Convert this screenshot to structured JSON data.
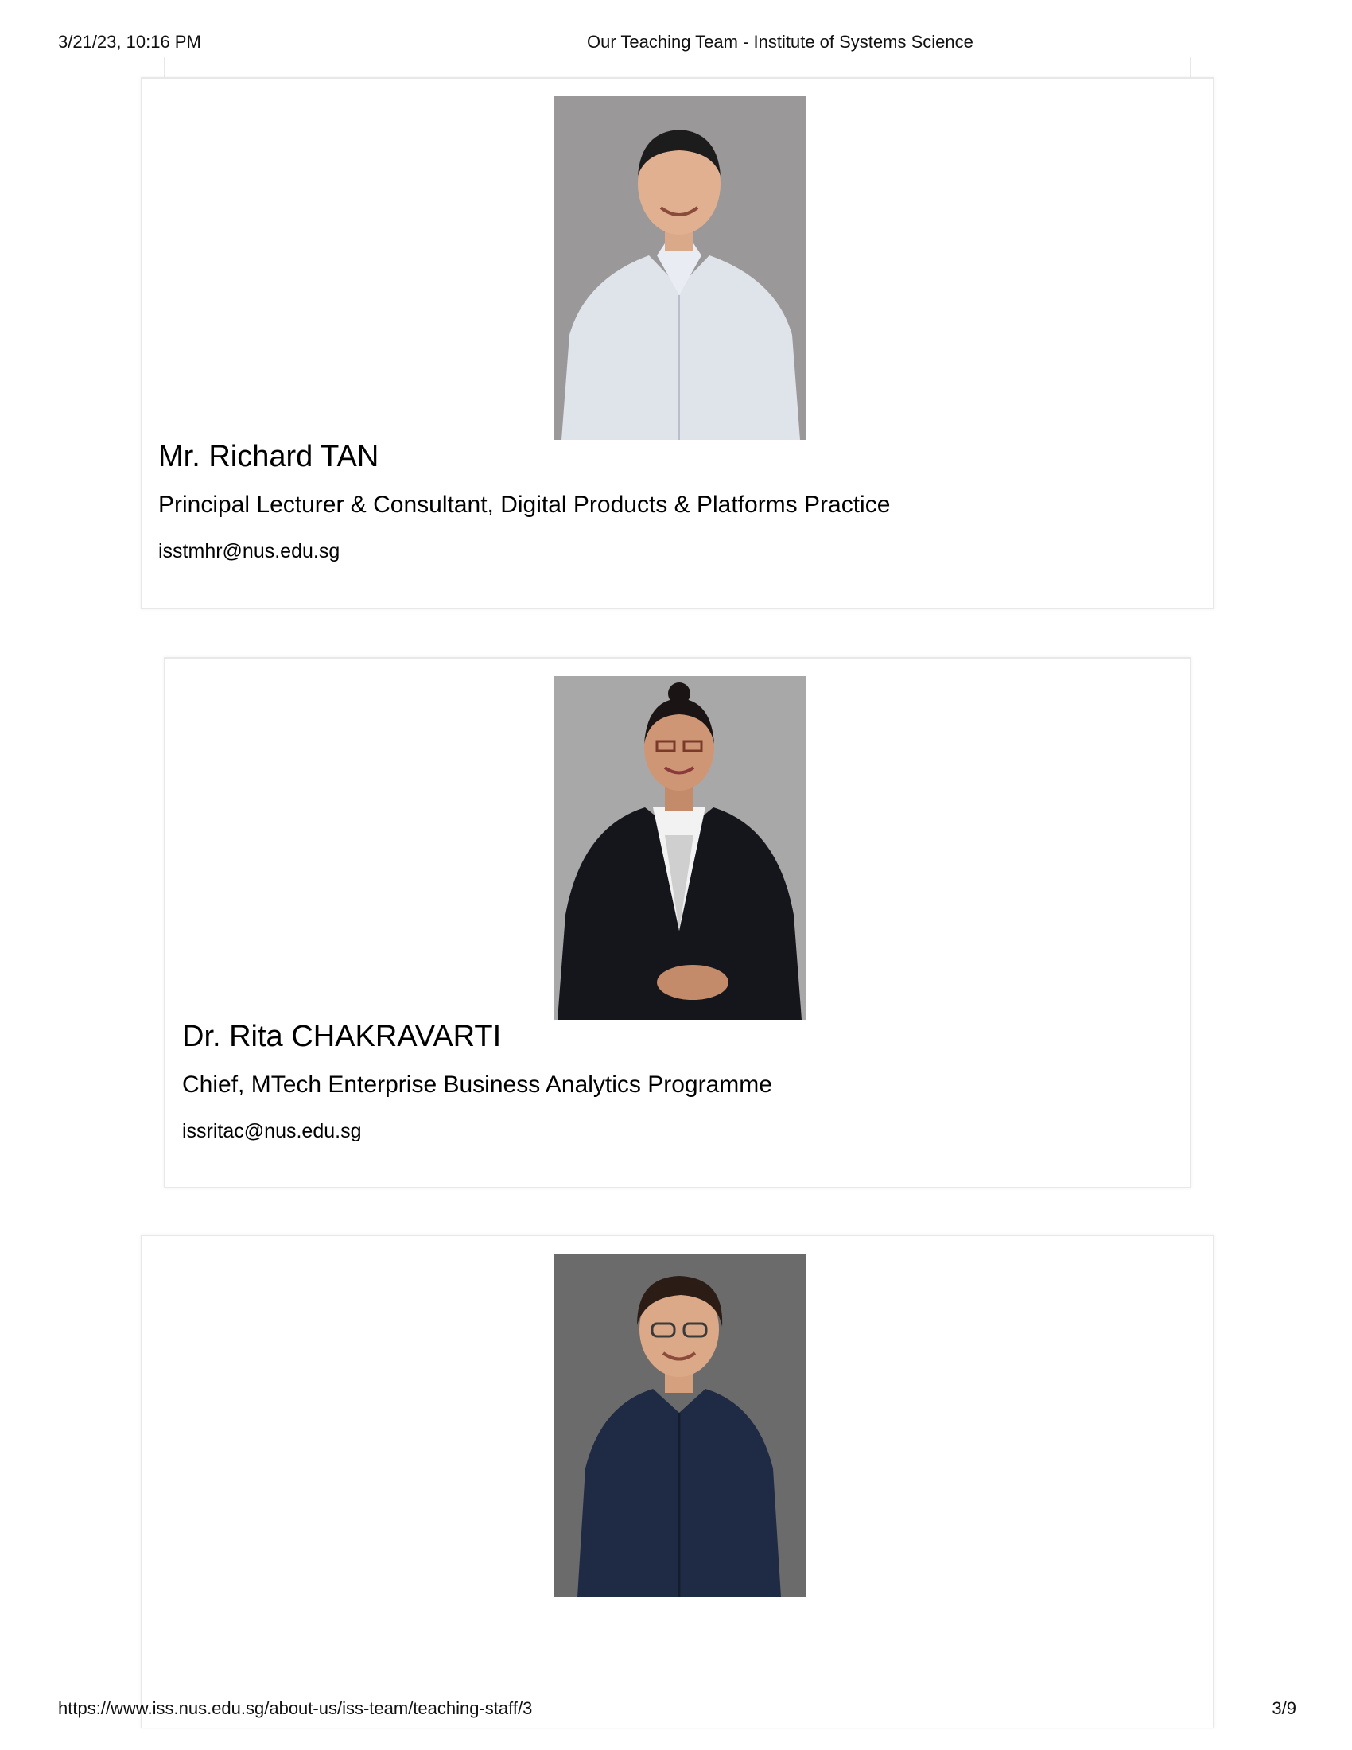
{
  "print_header": {
    "datetime": "3/21/23, 10:16 PM",
    "title": "Our Teaching Team - Institute of Systems Science"
  },
  "staff": [
    {
      "name": "Mr. Richard TAN",
      "role": "Principal Lecturer & Consultant, Digital Products & Platforms Practice",
      "email": "isstmhr@nus.edu.sg",
      "photo_bg": "#9a9898"
    },
    {
      "name": "Dr. Rita CHAKRAVARTI",
      "role": "Chief, MTech Enterprise Business Analytics Programme",
      "email": "issritac@nus.edu.sg",
      "photo_bg": "#a9a8a8"
    },
    {
      "photo_bg": "#6b6b6b"
    }
  ],
  "print_footer": {
    "url": "https://www.iss.nus.edu.sg/about-us/iss-team/teaching-staff/3",
    "page": "3/9"
  }
}
